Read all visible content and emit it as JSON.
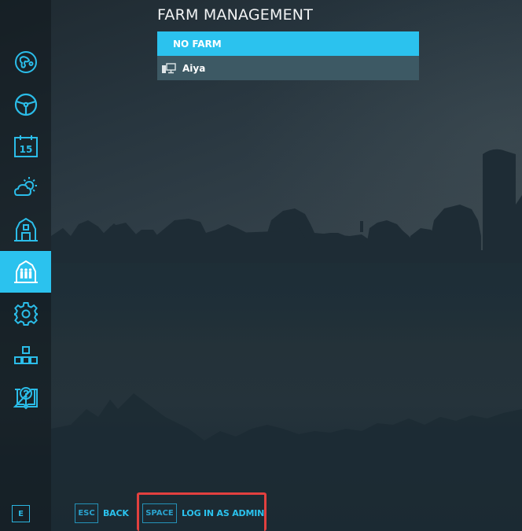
{
  "screen": {
    "title": "FARM MANAGEMENT"
  },
  "sidebar": {
    "items": [
      {
        "name": "map",
        "icon": "globe-map-icon",
        "active": false
      },
      {
        "name": "vehicles",
        "icon": "steering-wheel-icon",
        "active": false
      },
      {
        "name": "calendar",
        "icon": "calendar-icon",
        "calendar_day": "15",
        "active": false
      },
      {
        "name": "weather",
        "icon": "weather-icon",
        "active": false
      },
      {
        "name": "farm",
        "icon": "barn-icon",
        "active": false
      },
      {
        "name": "farm-management",
        "icon": "barn-people-icon",
        "active": true
      },
      {
        "name": "settings",
        "icon": "gear-icon",
        "active": false
      },
      {
        "name": "hierarchy",
        "icon": "hierarchy-icon",
        "active": false
      },
      {
        "name": "help",
        "icon": "help-book-icon",
        "active": false
      }
    ],
    "bottom_key": "E"
  },
  "farms": {
    "selected": "NO FARM",
    "players": [
      {
        "name": "Aiya",
        "icon": "pc-player-icon"
      }
    ]
  },
  "footer": {
    "back": {
      "key": "ESC",
      "label": "BACK"
    },
    "admin": {
      "key": "SPACE",
      "label": "LOG IN AS ADMIN",
      "highlighted": true
    }
  },
  "colors": {
    "accent": "#2bc2ee",
    "player_row": "#3d5964",
    "highlight": "#e2403f"
  }
}
